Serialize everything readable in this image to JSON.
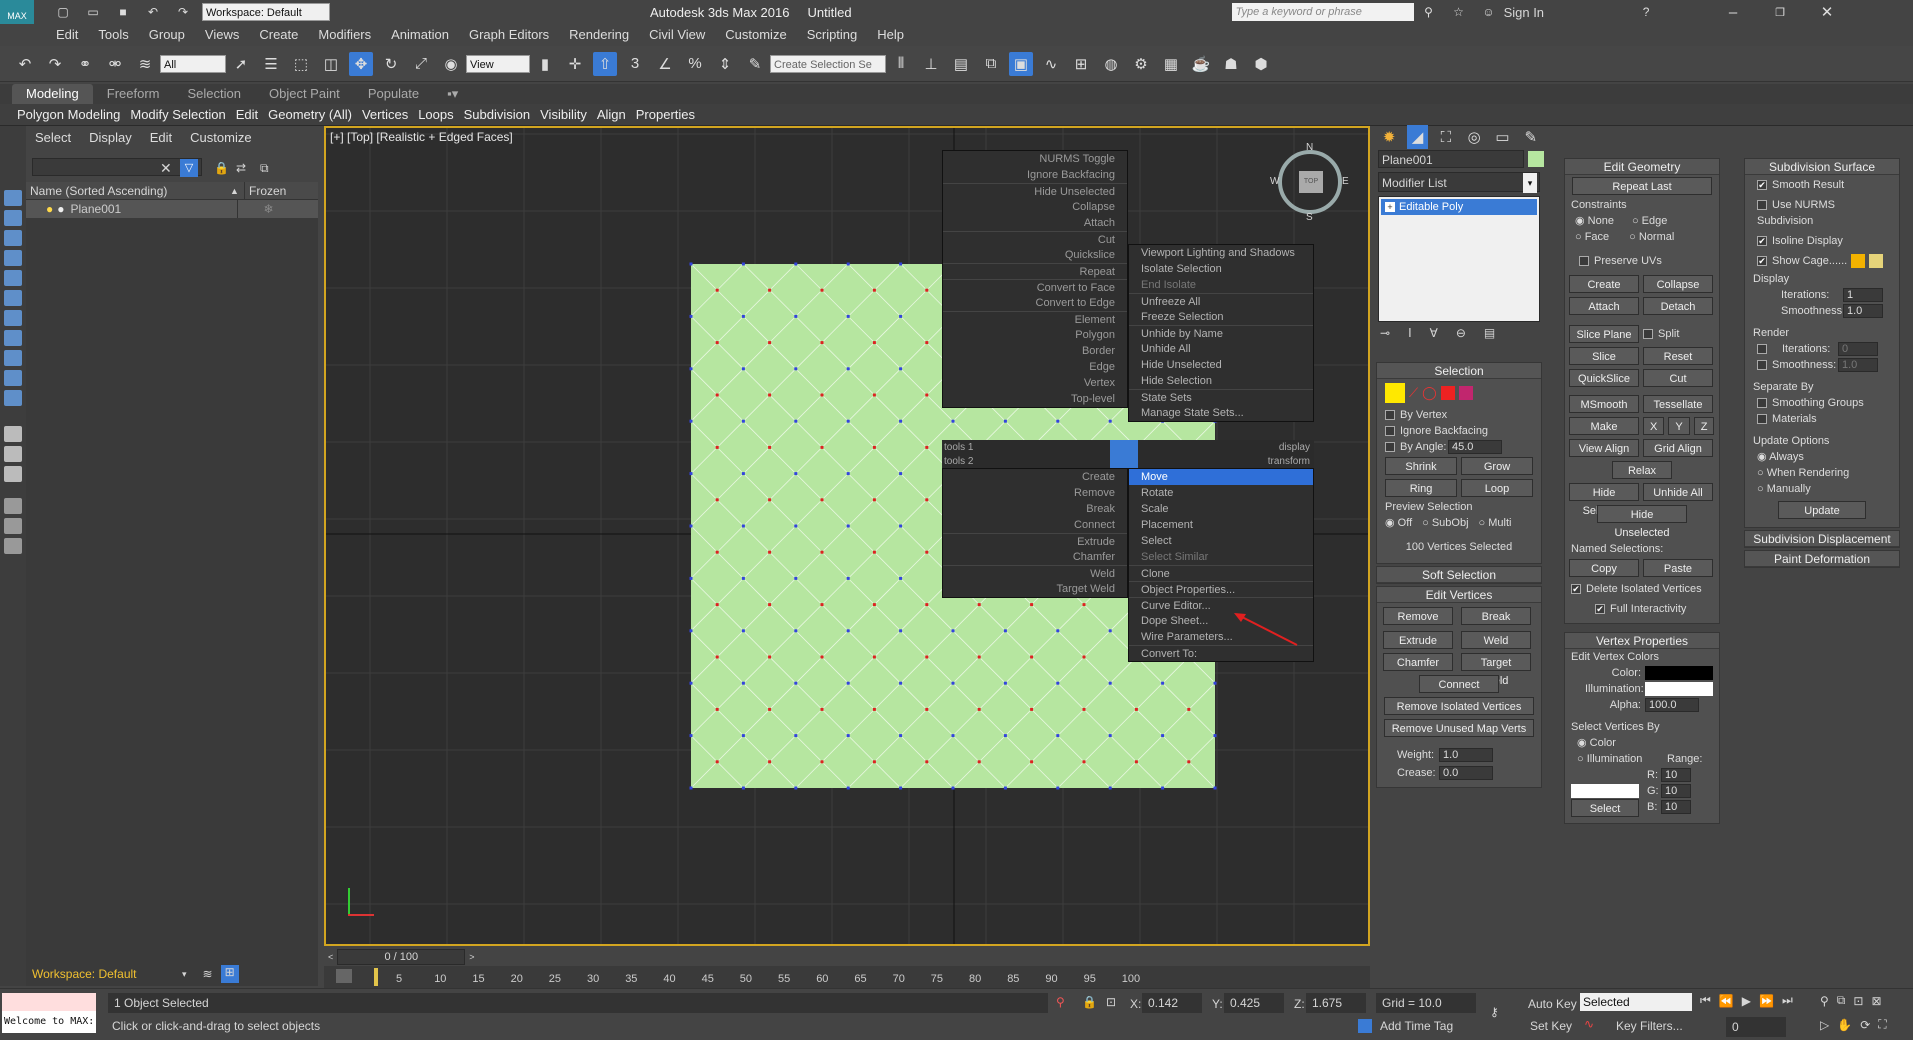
{
  "title": {
    "workspace_label": "Workspace: Default",
    "app_title": "Autodesk 3ds Max 2016",
    "doc_title": "Untitled",
    "search_placeholder": "Type a keyword or phrase",
    "sign_in": "Sign In"
  },
  "menu": [
    "Edit",
    "Tools",
    "Group",
    "Views",
    "Create",
    "Modifiers",
    "Animation",
    "Graph Editors",
    "Rendering",
    "Civil View",
    "Customize",
    "Scripting",
    "Help"
  ],
  "toolbar": {
    "filter_value": "All",
    "coord_value": "View",
    "selection_set_placeholder": "Create Selection Se"
  },
  "ribbon_tabs": [
    "Modeling",
    "Freeform",
    "Selection",
    "Object Paint",
    "Populate"
  ],
  "ribbon_items": [
    "Polygon Modeling",
    "Modify Selection",
    "Edit",
    "Geometry (All)",
    "Vertices",
    "Loops",
    "Subdivision",
    "Visibility",
    "Align",
    "Properties"
  ],
  "scene": {
    "tabs": [
      "Select",
      "Display",
      "Edit",
      "Customize"
    ],
    "col_name": "Name (Sorted Ascending)",
    "col_frozen": "Frozen",
    "object": "Plane001",
    "workspace": "Workspace: Default"
  },
  "viewport": {
    "label": "[+] [Top] [Realistic + Edged Faces]",
    "compass_n": "N",
    "compass_s": "S",
    "compass_e": "E",
    "compass_w": "W",
    "cube_label": "TOP"
  },
  "quad_left": [
    {
      "label": "NURMS Toggle"
    },
    {
      "label": "Ignore Backfacing"
    },
    {
      "label": "Hide Unselected",
      "sep": true
    },
    {
      "label": "Collapse"
    },
    {
      "label": "Attach"
    },
    {
      "label": "Cut",
      "sep": true
    },
    {
      "label": "Quickslice"
    },
    {
      "label": "Repeat",
      "sep": true
    },
    {
      "label": "Convert to Face",
      "sep": true
    },
    {
      "label": "Convert to Edge"
    },
    {
      "label": "Element",
      "sep": true
    },
    {
      "label": "Polygon"
    },
    {
      "label": "Border"
    },
    {
      "label": "Edge"
    },
    {
      "label": "Vertex"
    },
    {
      "label": "Top-level"
    }
  ],
  "quad_left_bottom": [
    {
      "label": "Create"
    },
    {
      "label": "Remove"
    },
    {
      "label": "Break"
    },
    {
      "label": "Connect"
    },
    {
      "label": "Extrude",
      "sep": true
    },
    {
      "label": "Chamfer"
    },
    {
      "label": "Weld",
      "sep": true
    },
    {
      "label": "Target Weld"
    }
  ],
  "quad_right": [
    {
      "label": "Viewport Lighting and Shadows"
    },
    {
      "label": "Isolate Selection"
    },
    {
      "label": "End Isolate",
      "dim": true
    },
    {
      "label": "Unfreeze All",
      "sep": true
    },
    {
      "label": "Freeze Selection"
    },
    {
      "label": "Unhide by Name",
      "sep": true
    },
    {
      "label": "Unhide All"
    },
    {
      "label": "Hide Unselected"
    },
    {
      "label": "Hide Selection"
    },
    {
      "label": "State Sets",
      "sep": true
    },
    {
      "label": "Manage State Sets..."
    }
  ],
  "quad_right_bottom": [
    {
      "label": "Move",
      "hl": true
    },
    {
      "label": "Rotate"
    },
    {
      "label": "Scale"
    },
    {
      "label": "Placement"
    },
    {
      "label": "Select"
    },
    {
      "label": "Select Similar",
      "dim": true
    },
    {
      "label": "Clone",
      "sep": true
    },
    {
      "label": "Object Properties...",
      "sep": true
    },
    {
      "label": "Curve Editor...",
      "sep": true
    },
    {
      "label": "Dope Sheet..."
    },
    {
      "label": "Wire Parameters..."
    },
    {
      "label": "Convert To:",
      "sep": true
    }
  ],
  "quad_headers": {
    "tools1": "tools 1",
    "display": "display",
    "tools2": "tools 2",
    "transform": "transform"
  },
  "command": {
    "object_name": "Plane001",
    "modifier_list": "Modifier List",
    "stack_item": "Editable Poly",
    "selection": {
      "title": "Selection",
      "by_vertex": "By Vertex",
      "ignore_backfacing": "Ignore Backfacing",
      "by_angle": "By Angle:",
      "angle_value": "45.0",
      "shrink": "Shrink",
      "grow": "Grow",
      "ring": "Ring",
      "loop": "Loop",
      "preview": "Preview Selection",
      "off": "Off",
      "subobj": "SubObj",
      "multi": "Multi",
      "status": "100 Vertices Selected"
    },
    "soft_selection": "Soft Selection",
    "edit_vertices": {
      "title": "Edit Vertices",
      "remove": "Remove",
      "break": "Break",
      "extrude": "Extrude",
      "weld": "Weld",
      "chamfer": "Chamfer",
      "target_weld": "Target Weld",
      "connect": "Connect",
      "remove_isolated": "Remove Isolated Vertices",
      "remove_unused": "Remove Unused Map Verts",
      "weight_label": "Weight:",
      "weight": "1.0",
      "crease_label": "Crease:",
      "crease": "0.0"
    },
    "edit_geometry": {
      "title": "Edit Geometry",
      "repeat_last": "Repeat Last",
      "constraints": "Constraints",
      "none": "None",
      "edge": "Edge",
      "face": "Face",
      "normal": "Normal",
      "preserve_uvs": "Preserve UVs",
      "create": "Create",
      "collapse": "Collapse",
      "attach": "Attach",
      "detach": "Detach",
      "slice_plane": "Slice Plane",
      "split": "Split",
      "slice": "Slice",
      "reset_plane": "Reset Plane",
      "quickslice": "QuickSlice",
      "cut": "Cut",
      "msmooth": "MSmooth",
      "tessellate": "Tessellate",
      "make_planar": "Make Planar",
      "x": "X",
      "y": "Y",
      "z": "Z",
      "view_align": "View Align",
      "grid_align": "Grid Align",
      "relax": "Relax",
      "hide_selected": "Hide Selected",
      "unhide_all": "Unhide All",
      "hide_unselected": "Hide Unselected",
      "named_selections": "Named Selections:",
      "copy": "Copy",
      "paste": "Paste",
      "delete_isolated": "Delete Isolated Vertices",
      "full_interactivity": "Full Interactivity"
    },
    "vertex_properties": {
      "title": "Vertex Properties",
      "edit_colors": "Edit Vertex Colors",
      "color": "Color:",
      "illumination": "Illumination:",
      "alpha_label": "Alpha:",
      "alpha": "100.0",
      "select_by": "Select Vertices By",
      "by_color": "Color",
      "by_illum": "Illumination",
      "range": "Range:",
      "r_label": "R:",
      "g_label": "G:",
      "b_label": "B:",
      "r": "10",
      "g": "10",
      "b": "10",
      "select": "Select"
    },
    "subdivision": {
      "title": "Subdivision Surface",
      "smooth_result": "Smooth Result",
      "use_nurms": "Use NURMS Subdivision",
      "isoline": "Isoline Display",
      "show_cage": "Show Cage......",
      "display": "Display",
      "iterations_label": "Iterations:",
      "iterations": "1",
      "smoothness_label": "Smoothness:",
      "smoothness": "1.0",
      "render": "Render",
      "r_iterations": "0",
      "r_smoothness": "1.0",
      "separate_by": "Separate By",
      "smoothing_groups": "Smoothing Groups",
      "materials": "Materials",
      "update_options": "Update Options",
      "always": "Always",
      "when_rendering": "When Rendering",
      "manually": "Manually",
      "update": "Update"
    },
    "subdiv_displacement": "Subdivision Displacement",
    "paint_deformation": "Paint Deformation"
  },
  "timeline": {
    "frame": "0 / 100",
    "ticks": [
      "5",
      "10",
      "15",
      "20",
      "25",
      "30",
      "35",
      "40",
      "45",
      "50",
      "55",
      "60",
      "65",
      "70",
      "75",
      "80",
      "85",
      "90",
      "95",
      "100"
    ]
  },
  "status": {
    "welcome": "Welcome to MAX:",
    "selected": "1 Object Selected",
    "prompt": "Click or click-and-drag to select objects",
    "x_label": "X:",
    "x": "0.142",
    "y_label": "Y:",
    "y": "0.425",
    "z_label": "Z:",
    "z": "1.675",
    "grid": "Grid = 10.0",
    "add_time_tag": "Add Time Tag",
    "auto_key": "Auto Key",
    "selected_mode": "Selected",
    "set_key": "Set Key",
    "key_filters": "Key Filters...",
    "frame": "0"
  },
  "colors": {
    "accent": "#3a7bd5",
    "viewport_border": "#d2a520",
    "plane": "#b6e6a0",
    "vertex_blue": "#3344dd",
    "vertex_red": "#dd2222"
  }
}
